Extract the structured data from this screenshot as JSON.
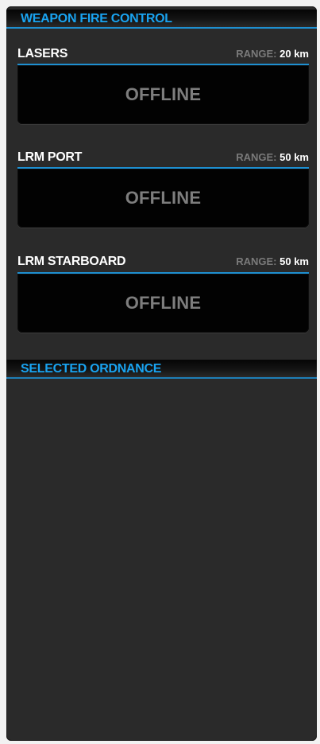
{
  "weapon_fire_control": {
    "title": "WEAPON FIRE CONTROL",
    "weapons": [
      {
        "name": "LASERS",
        "range_label": "RANGE:",
        "range_value": "20 km",
        "status": "OFFLINE"
      },
      {
        "name": "LRM PORT",
        "range_label": "RANGE:",
        "range_value": "50 km",
        "status": "OFFLINE"
      },
      {
        "name": "LRM STARBOARD",
        "range_label": "RANGE:",
        "range_value": "50 km",
        "status": "OFFLINE"
      }
    ]
  },
  "selected_ordnance": {
    "title": "SELECTED ORDNANCE"
  },
  "colors": {
    "accent": "#19a3f0",
    "panel_bg": "#2a2a2a",
    "status_box_bg": "#020202",
    "offline_text": "#7d7d7d"
  }
}
